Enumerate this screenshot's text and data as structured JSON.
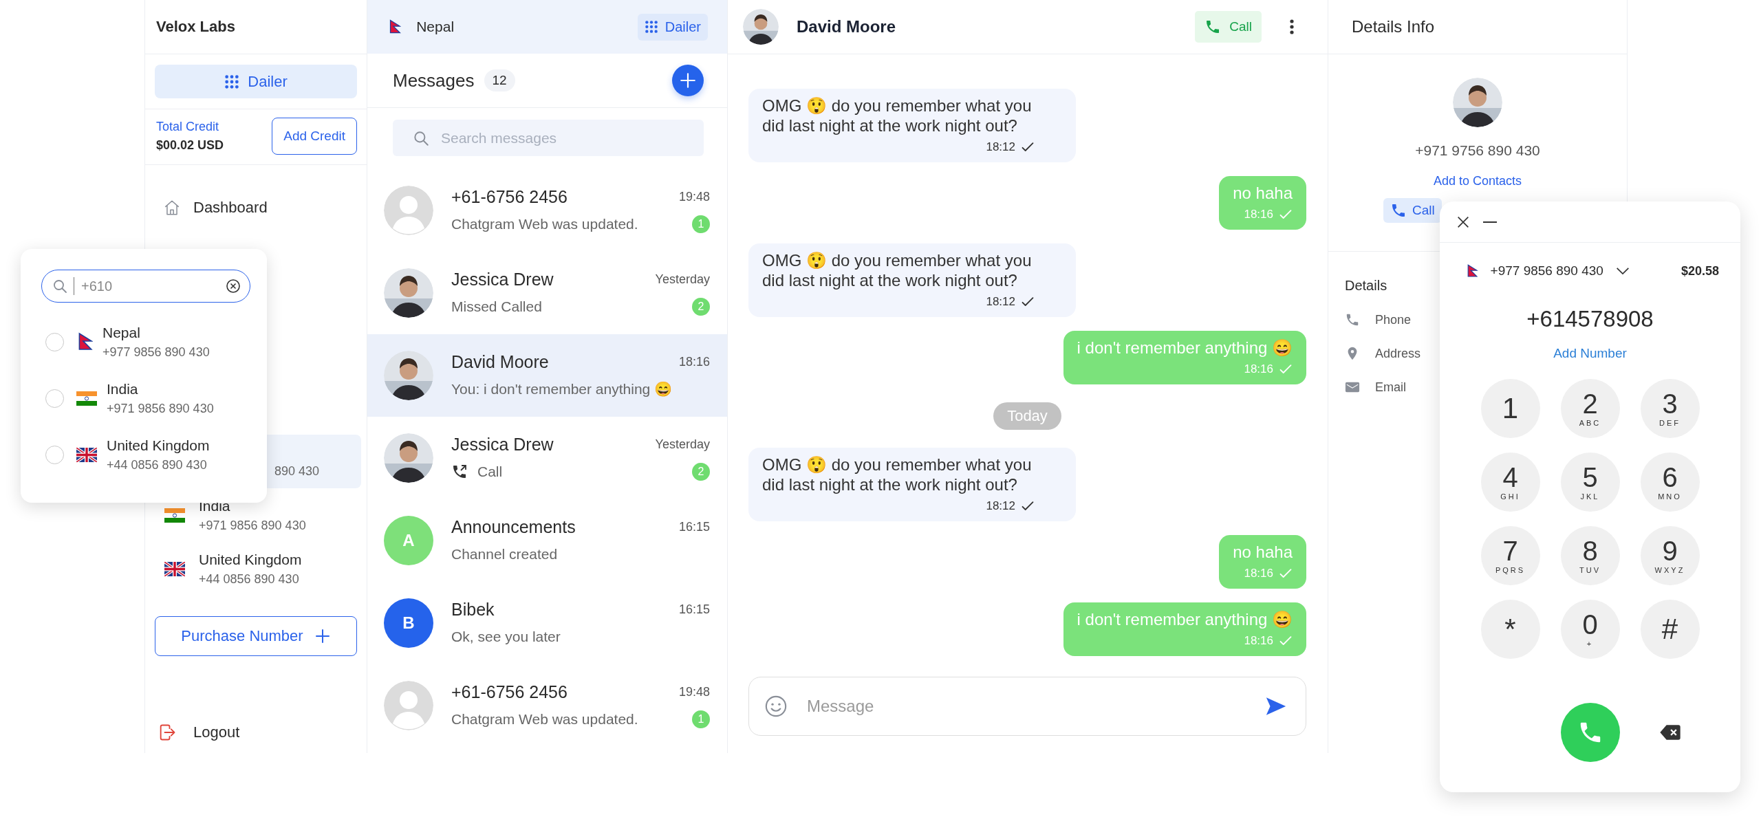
{
  "sidebar": {
    "brand": "Velox Labs",
    "dialer_button": "Dailer",
    "credit_label": "Total Credit",
    "credit_amount": "$00.02 USD",
    "add_credit": "Add Credit",
    "nav": [
      {
        "label": "Dashboard"
      }
    ],
    "numbers": [
      {
        "number": "890 430",
        "partial": true,
        "selected": true
      },
      {
        "name": "India",
        "number": "+971 9856 890 430",
        "partial": false,
        "selected": false
      },
      {
        "name": "United Kingdom",
        "number": "+44 0856 890 430",
        "partial": false,
        "selected": false
      }
    ],
    "purchase_button": "Purchase Number",
    "logout": "Logout"
  },
  "country_popup": {
    "search": {
      "value": "+610"
    },
    "countries": [
      {
        "name": "Nepal",
        "number": "+977 9856 890 430",
        "selected": false
      },
      {
        "name": "India",
        "number": "+971 9856 890 430",
        "selected": false
      },
      {
        "name": "United Kingdom",
        "number": "+44 0856 890 430",
        "selected": false
      }
    ]
  },
  "messages_panel": {
    "country": {
      "name": "Nepal"
    },
    "dialer_chip": "Dailer",
    "title": "Messages",
    "count": "12",
    "search": {
      "placeholder": "Search messages"
    },
    "conversations": [
      {
        "name": "+61-6756 2456",
        "time": "19:48",
        "kind": "text",
        "preview": "Chatgram Web was updated.",
        "unread": "1",
        "avatar": {
          "kind": "placeholder"
        },
        "selected": false
      },
      {
        "name": "Jessica Drew",
        "time": "Yesterday",
        "kind": "text",
        "preview": "Missed Called",
        "unread": "2",
        "avatar": {
          "kind": "photo"
        },
        "selected": false
      },
      {
        "name": "David Moore",
        "time": "18:16",
        "kind": "text",
        "preview": "You: i don't remember anything 😄",
        "avatar": {
          "kind": "photo"
        },
        "selected": true
      },
      {
        "name": "Jessica Drew",
        "time": "Yesterday",
        "kind": "call",
        "preview": "Call",
        "unread": "2",
        "avatar": {
          "kind": "photo"
        },
        "selected": false
      },
      {
        "name": "Announcements",
        "time": "16:15",
        "kind": "text",
        "preview": "Channel created",
        "avatar": {
          "kind": "letter",
          "letter": "A",
          "color": "#7ee07a"
        },
        "selected": false
      },
      {
        "name": "Bibek",
        "time": "16:15",
        "kind": "text",
        "preview": "Ok, see you later",
        "avatar": {
          "kind": "letter",
          "letter": "B",
          "color": "#2563eb"
        },
        "selected": false
      },
      {
        "name": "+61-6756 2456",
        "time": "19:48",
        "kind": "text",
        "preview": "Chatgram Web was updated.",
        "unread": "1",
        "avatar": {
          "kind": "placeholder"
        },
        "selected": false
      }
    ]
  },
  "chat": {
    "contact": {
      "name": "David Moore",
      "avatar": {
        "kind": "photo"
      }
    },
    "call_button": "Call",
    "messages": [
      {
        "kind": "received",
        "text": "OMG 😲 do you remember what you did last night at the work night out?",
        "time": "18:12"
      },
      {
        "kind": "sent",
        "text": "no haha",
        "time": "18:16"
      },
      {
        "kind": "received",
        "text": "OMG 😲 do you remember what you did last night at the work night out?",
        "time": "18:12"
      },
      {
        "kind": "sent",
        "text": "i don't remember anything 😄",
        "time": "18:16"
      },
      {
        "kind": "divider",
        "text": "Today"
      },
      {
        "kind": "received",
        "text": "OMG 😲 do you remember what you did last night at the work night out?",
        "time": "18:12"
      },
      {
        "kind": "sent",
        "text": "no haha",
        "time": "18:16"
      },
      {
        "kind": "sent",
        "text": "i don't remember anything 😄",
        "time": "18:16"
      }
    ],
    "composer": {
      "placeholder": "Message"
    }
  },
  "details": {
    "title": "Details Info",
    "avatar": {
      "kind": "photo"
    },
    "phone": "+971 9756 890 430",
    "add_contact": "Add to Contacts",
    "call_button": "Call",
    "section_title": "Details",
    "fields": [
      {
        "label": "Phone"
      },
      {
        "label": "Address"
      },
      {
        "label": "Email"
      }
    ]
  },
  "dialer": {
    "line": {
      "number": "+977 9856 890 430"
    },
    "balance": "$20.58",
    "entered": "+614578908",
    "add_number": "Add Number",
    "keys": [
      {
        "digit": "1"
      },
      {
        "digit": "2",
        "letters": "ABC"
      },
      {
        "digit": "3",
        "letters": "DEF"
      },
      {
        "digit": "4",
        "letters": "GHI"
      },
      {
        "digit": "5",
        "letters": "JKL"
      },
      {
        "digit": "6",
        "letters": "MNO"
      },
      {
        "digit": "7",
        "letters": "PQRS"
      },
      {
        "digit": "8",
        "letters": "TUV"
      },
      {
        "digit": "9",
        "letters": "WXYZ"
      },
      {
        "digit": "*"
      },
      {
        "digit": "0",
        "letters": "+"
      },
      {
        "digit": "#"
      }
    ]
  }
}
